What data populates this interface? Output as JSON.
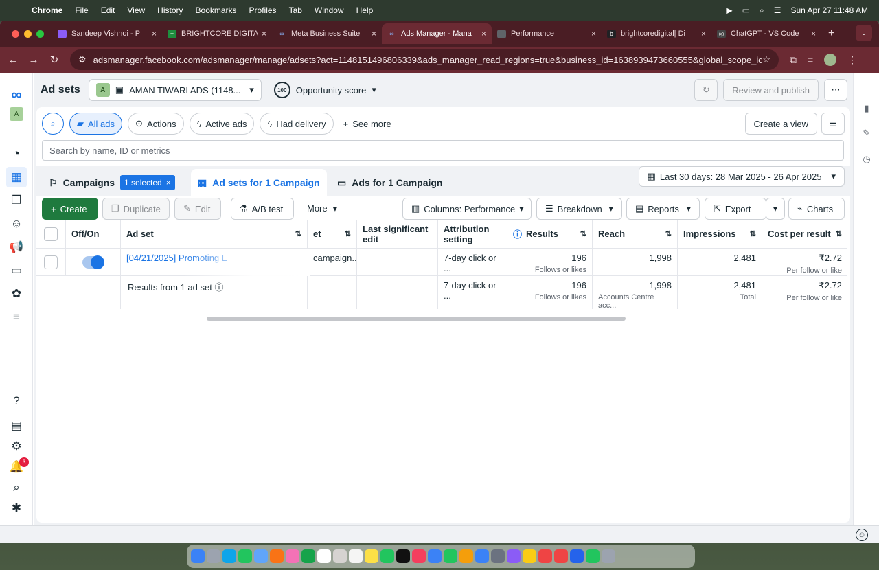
{
  "menubar": {
    "app": "Chrome",
    "items": [
      "File",
      "Edit",
      "View",
      "History",
      "Bookmarks",
      "Profiles",
      "Tab",
      "Window",
      "Help"
    ],
    "datetime": "Sun Apr 27  11:48 AM"
  },
  "tabs": [
    {
      "title": "Sandeep Vishnoi - P",
      "color": "#8b5cf6"
    },
    {
      "title": "BRIGHTCORE DIGITA",
      "color": "#1e8e3e"
    },
    {
      "title": "Meta Business Suite",
      "color": "#1b74e4"
    },
    {
      "title": "Ads Manager - Mana",
      "color": "#1b74e4"
    },
    {
      "title": "Performance",
      "color": "#5f6368"
    },
    {
      "title": "brightcoredigital| Di",
      "color": "#202124"
    },
    {
      "title": "ChatGPT - VS Code",
      "color": "#444"
    }
  ],
  "url": "adsmanager.facebook.com/adsmanager/manage/adsets?act=1148151496806339&ads_manager_read_regions=true&business_id=1638939473660555&global_scope_id...",
  "header": {
    "title": "Ad sets",
    "account_badge": "A",
    "account": "AMAN TIWARI ADS (1148...",
    "opp_score": "100",
    "opp_label": "Opportunity score",
    "review": "Review and publish"
  },
  "filters": {
    "all_ads": "All ads",
    "actions": "Actions",
    "active_ads": "Active ads",
    "had_delivery": "Had delivery",
    "see_more": "See more",
    "create_view": "Create a view"
  },
  "search": {
    "placeholder": "Search by name, ID or metrics"
  },
  "tabs_row": {
    "campaigns": "Campaigns",
    "selected": "1 selected",
    "adsets": "Ad sets for 1 Campaign",
    "ads": "Ads for 1 Campaign",
    "date": "Last 30 days: 28 Mar 2025 - 26 Apr 2025"
  },
  "actions": {
    "create": "Create",
    "duplicate": "Duplicate",
    "edit": "Edit",
    "ab": "A/B test",
    "more": "More",
    "columns": "Columns: Performance",
    "breakdown": "Breakdown",
    "reports": "Reports",
    "export": "Export",
    "charts": "Charts"
  },
  "table": {
    "headers": {
      "onoff": "Off/On",
      "adset": "Ad set",
      "budget": "et",
      "last_edit": "Last significant edit",
      "attribution": "Attribution setting",
      "results": "Results",
      "reach": "Reach",
      "impressions": "Impressions",
      "cpr": "Cost per result"
    },
    "row": {
      "name": "[04/21/2025] Promoting E",
      "budget": "campaign...",
      "attribution": "7-day click or ...",
      "results": "196",
      "results_sub": "Follows or likes",
      "reach": "1,998",
      "impressions": "2,481",
      "cpr": "₹2.72",
      "cpr_sub": "Per follow or like"
    },
    "summary": {
      "label": "Results from 1 ad set",
      "last_edit": "—",
      "attribution": "7-day click or ...",
      "results": "196",
      "results_sub": "Follows or likes",
      "reach": "1,998",
      "reach_sub": "Accounts Centre acc...",
      "impressions": "2,481",
      "impressions_sub": "Total",
      "cpr": "₹2.72",
      "cpr_sub": "Per follow or like"
    }
  },
  "nav": {
    "notifications": "3",
    "avatar": "A"
  }
}
